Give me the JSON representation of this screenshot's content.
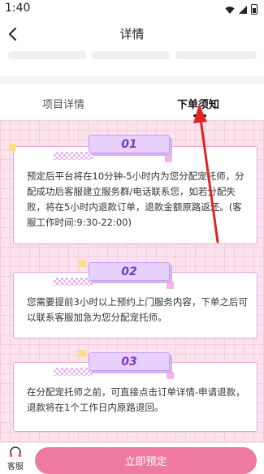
{
  "status_bar": {
    "time": "1:40"
  },
  "nav": {
    "title": "详情"
  },
  "tabs": [
    {
      "label": "项目详情",
      "active": false
    },
    {
      "label": "下单须知",
      "active": true
    }
  ],
  "notices": [
    {
      "number": "01",
      "text": "预定后平台将在10分钟-5小时内为您分配宠托师，分配成功后客服建立服务群/电话联系您，如若分配失败，将在5小时内退款订单，退款金额原路返还。(客服工作时间:9:30-22:00)"
    },
    {
      "number": "02",
      "text": "您需要提前3小时以上预约上门服务内容，下单之后可以联系客服加急为您分配宠托师。"
    },
    {
      "number": "03",
      "text": "在分配宠托师之前，可直接点击订单详情-申请退款，退款将在1个工作日内原路退回。"
    }
  ],
  "bottom_bar": {
    "service_label": "客服",
    "book_label": "立即预定"
  },
  "colors": {
    "accent": "#ee7aa0",
    "annotation_arrow": "#e02424",
    "tag": "#e7d0fb"
  },
  "icons": [
    "back-icon",
    "wifi-icon",
    "signal-icon",
    "battery-icon",
    "customer-service-icon"
  ]
}
